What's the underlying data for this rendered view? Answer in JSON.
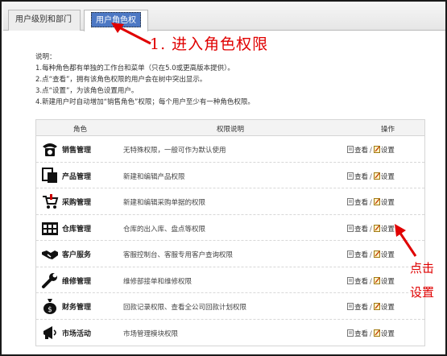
{
  "tabs": [
    {
      "label": "用户级别和部门"
    },
    {
      "label": "用户角色权限"
    }
  ],
  "annotation_top": "1. 进入角色权限",
  "annotation_side": [
    "点击",
    "设置"
  ],
  "notes": [
    "说明：",
    "1.每种角色都有单独的工作台和菜单（只在5.0或更高版本提供）。",
    "2.点“查看”，拥有该角色权限的用户会在树中突出显示。",
    "3.点“设置”，为该角色设置用户。",
    "4.新建用户时自动增加“销售角色”权限；每个用户至少有一种角色权限。"
  ],
  "table": {
    "headers": {
      "role": "角色",
      "desc": "权限说明",
      "ops": "操作"
    },
    "view_label": "查看",
    "set_label": "设置",
    "rows": [
      {
        "name": "销售管理",
        "desc": "无特殊权限，一般可作为默认使用",
        "icon": "phone-icon"
      },
      {
        "name": "产品管理",
        "desc": "新建和编辑产品权限",
        "icon": "product-icon"
      },
      {
        "name": "采购管理",
        "desc": "新建和编辑采购单据的权限",
        "icon": "cart-icon"
      },
      {
        "name": "仓库管理",
        "desc": "仓库的出入库、盘点等权限",
        "icon": "warehouse-icon"
      },
      {
        "name": "客户服务",
        "desc": "客服控制台、客服专用客户查询权限",
        "icon": "handshake-icon"
      },
      {
        "name": "维修管理",
        "desc": "维修部接单和维修权限",
        "icon": "wrench-icon"
      },
      {
        "name": "财务管理",
        "desc": "回款记录权限、查看全公司回款计划权限",
        "icon": "money-bag-icon"
      },
      {
        "name": "市场活动",
        "desc": "市场管理模块权限",
        "icon": "megaphone-icon"
      }
    ]
  },
  "colors": {
    "tab_active": "#4d78c4",
    "annotation": "#e00000"
  }
}
